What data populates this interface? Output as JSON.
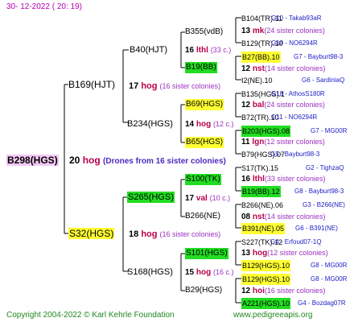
{
  "header": {
    "date": "30- 12-2022 ( 20: 19)"
  },
  "footer": {
    "copyright": "Copyright 2004-2022 © Karl Kehrle Foundation",
    "url": "www.pedigreeapis.org"
  },
  "queen": {
    "name": "B298(HGS)",
    "gen_num": "20",
    "code": "hog",
    "note": "(Drones from 16 sister colonies)"
  },
  "sire": {
    "name": "B169(HJT)",
    "gen_num": "17",
    "code": "hog",
    "sisters": "(16 sister colonies)"
  },
  "dam": {
    "name": "S32(HGS)",
    "gen_num": "18",
    "code": "hog",
    "sisters": "(16 sister colonies)"
  },
  "gen3": {
    "B40": {
      "name": "B40(HJT)",
      "gen_num": "16",
      "code": "lthl",
      "sisters": "(33 c.)"
    },
    "B234": {
      "name": "B234(HGS)",
      "gen_num": "14",
      "code": "hog",
      "sisters": "(12 c.)"
    },
    "S265": {
      "name": "S265(HGS)",
      "gen_num": "17",
      "code": "val",
      "sisters": "(10 c.)"
    },
    "S168": {
      "name": "S168(HGS)",
      "gen_num": "15",
      "code": "hog",
      "sisters": "(16 c.)"
    }
  },
  "gen4": {
    "B355": {
      "name": "B355(vdB)",
      "gen_num": "13",
      "code": "mk",
      "sisters": "(24 sister colonies)"
    },
    "B19": {
      "name": "B19(BB)",
      "gen_num": "12",
      "code": "nst",
      "sisters": "(14 sister colonies)"
    },
    "B69": {
      "name": "B69(HGS)",
      "gen_num": "12",
      "code": "bal",
      "sisters": "(24 sister colonies)"
    },
    "B65": {
      "name": "B65(HGS)",
      "gen_num": "11",
      "code": "lgn",
      "sisters": "(12 sister colonies)"
    },
    "S100": {
      "name": "S100(TK)",
      "gen_num": "16",
      "code": "lthl",
      "sisters": "(33 sister colonies)"
    },
    "B266": {
      "name": "B266(NE)",
      "gen_num": "08",
      "code": "nst",
      "sisters": "(14 sister colonies)"
    },
    "S101": {
      "name": "S101(HGS)",
      "gen_num": "13",
      "code": "hog",
      "sisters": "(12 sister colonies)"
    },
    "B29": {
      "name": "B29(HGS)",
      "gen_num": "12",
      "code": "hoi",
      "sisters": "(16 sister colonies)"
    }
  },
  "gen5": [
    {
      "name": "B104(TR).11",
      "extra": "G10 - Takab93aR"
    },
    {
      "name": "B129(TR).10",
      "extra": "G10 - NO6294R"
    },
    {
      "name": "B27(BB).10",
      "extra": "G7 - Bayburt98-3"
    },
    {
      "name": "I2(NE).10",
      "extra": "G6 - SardiniaQ"
    },
    {
      "name": "B135(HGS).1",
      "extra": "G18 - AthosS180R"
    },
    {
      "name": "B72(TR).10",
      "extra": "G11 - NO6294R"
    },
    {
      "name": "B203(HGS).08",
      "extra": "G7 - MG00R"
    },
    {
      "name": "B79(HGS).07",
      "extra": "G5 - Bayburt98-3"
    },
    {
      "name": "S17(TK).15",
      "extra": "G2 - TighzaQ"
    },
    {
      "name": "B19(BB).12",
      "extra": "G8 - Bayburt98-3"
    },
    {
      "name": "B266(NE).06",
      "extra": "G3 - B266(NE)"
    },
    {
      "name": "B391(NE).05",
      "extra": "G6 - B391(NE)"
    },
    {
      "name": "S227(TK).12",
      "extra": "G4 - Erfoud07-1Q"
    },
    {
      "name": "B129(HGS).10",
      "extra": "G8 - MG00R"
    },
    {
      "name": "B129(HGS).10",
      "extra": "G8 - MG00R"
    },
    {
      "name": "A221(HGS).10",
      "extra": "G4 - Bozdag07R"
    }
  ]
}
